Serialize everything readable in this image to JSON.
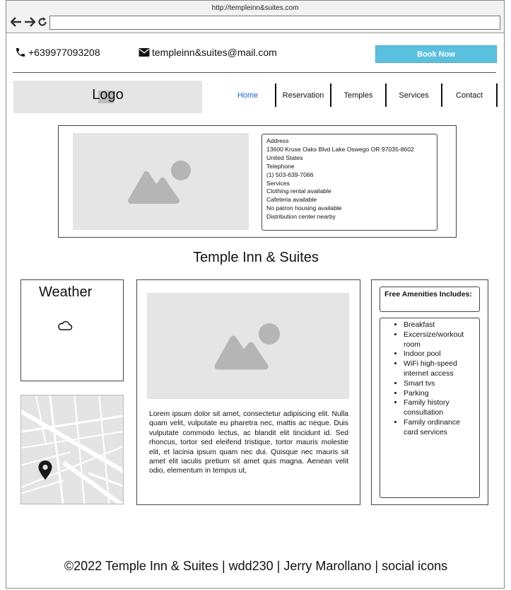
{
  "browser": {
    "url": "http://templeinn&suites.com"
  },
  "contact": {
    "phone": "+639977093208",
    "email": "templeinn&suites@mail.com",
    "book_label": "Book Now"
  },
  "header": {
    "logo": "Logo",
    "nav": [
      "Home",
      "Reservation",
      "Temples",
      "Services",
      "Contact"
    ],
    "active": "Home"
  },
  "info": {
    "address_label": "Address",
    "address_line": "13600 Kruse Oaks Blvd Lake Oswego OR 97035-8602",
    "country": "United States",
    "telephone_label": "Telephone",
    "telephone": "(1) 503-639-7066",
    "services_label": "Services",
    "services": [
      "Clothing rental available",
      "Cafeteria available",
      "No patron housing available",
      "Distribution center nearby"
    ]
  },
  "page_title": "Temple Inn & Suites",
  "weather": {
    "title": "Weather",
    "icon": "cloud-icon"
  },
  "main": {
    "text": "Lorem ipsum dolor sit amet, consectetur adipiscing elit. Nulla quam velit, vulputate eu pharetra nec, mattis ac neque. Duis vulputate commodo lectus, ac blandit elit tincidunt id. Sed rhoncus, tortor sed eleifend tristique, tortor mauris molestie elit, et lacinia ipsum quam nec dui. Quisque nec mauris sit amet elit iaculis pretium sit amet quis magna. Aenean velit odio, elementum in tempus ut,"
  },
  "amenities": {
    "title": "Free Amenities Includes:",
    "items": [
      "Breakfast",
      "Excersize/workout room",
      "Indoor pool",
      "WiFi high-speed internet access",
      "Smart tvs",
      "Parking",
      "Family history consultation",
      "Family ordinance card services"
    ]
  },
  "footer": "©2022 Temple Inn & Suites | wdd230 | Jerry Marollano | social icons",
  "colors": {
    "accent": "#5bc0de",
    "active_nav": "#1d5fd6",
    "placeholder": "#e5e5e5"
  }
}
